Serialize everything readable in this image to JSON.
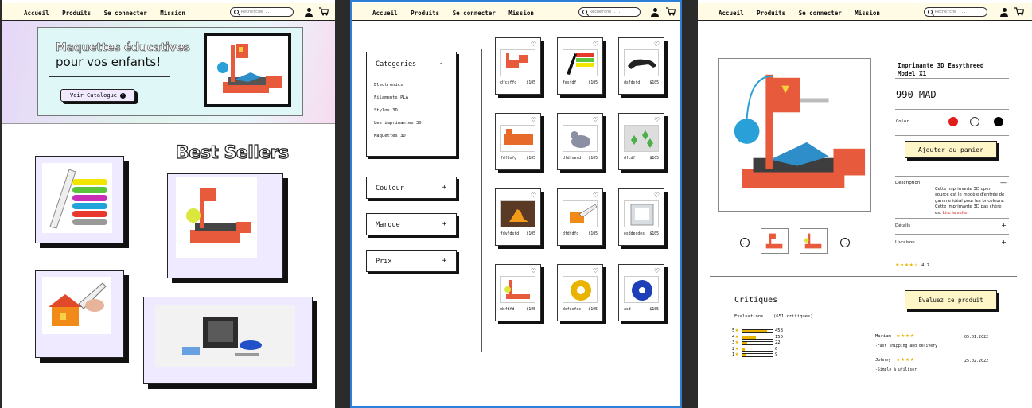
{
  "nav": {
    "home": "Accueil",
    "products": "Produits",
    "login": "Se connecter",
    "mission": "Mission",
    "search_placeholder": "Recherche ..."
  },
  "hero": {
    "title_line1": "Maquettes éducatives",
    "title_line2": "pour vos enfants!",
    "cta": "Voir Catalogue"
  },
  "best_sellers": {
    "title": "Best Sellers"
  },
  "filters": {
    "categories_title": "Categories",
    "categories_toggle": "-",
    "categories": [
      "Electronics",
      "Filaments PLA",
      "Stylos 3D",
      "Les imprimantes 3D",
      "Maquettes 3D"
    ],
    "color": "Couleur",
    "brand": "Marque",
    "price": "Prix",
    "expand": "+"
  },
  "products": [
    {
      "name": "dfcvffd",
      "price": "$105"
    },
    {
      "name": "fesfdf",
      "price": "$105"
    },
    {
      "name": "dsfdsfd",
      "price": "$105"
    },
    {
      "name": "fdfdsfg",
      "price": "$105"
    },
    {
      "name": "dfdfsesd",
      "price": "$105"
    },
    {
      "name": "dfcdf",
      "price": "$105"
    },
    {
      "name": "fdvfdsfd",
      "price": "$105"
    },
    {
      "name": "dfdfdfd",
      "price": "$105"
    },
    {
      "name": "esddesdes",
      "price": "$105"
    },
    {
      "name": "dsfdfd",
      "price": "$105"
    },
    {
      "name": "dsfdsfds",
      "price": "$105"
    },
    {
      "name": "asd",
      "price": "$105"
    }
  ],
  "product": {
    "title": "Imprimante 3D Easythreed Model X1",
    "price": "990 MAD",
    "color_label": "Color",
    "swatches": [
      "#e21b1b",
      "#ffffff",
      "#000000"
    ],
    "add_to_cart": "Ajouter au panier",
    "description_label": "Description",
    "description_toggle": "—",
    "description_text": "Cette imprimante 3D open source est le modèle d'entrée de gamme idéal pour les bricoleurs. Cette imprimante 3D pas chère est",
    "read_more": "Lire la suite",
    "details_label": "Détails",
    "delivery_label": "Livraison",
    "expand": "+",
    "rating_stars": "★★★★",
    "rating_half": "★",
    "rating_value": "4.7",
    "prev": "←",
    "next": "→"
  },
  "reviews": {
    "title": "Critiques",
    "evaluations_label": "Evaluations",
    "count_label": "(651 critiques)",
    "cta": "Évaluez ce produit",
    "star_glyph": "★",
    "distribution": [
      {
        "stars": "5",
        "count": "458",
        "fraction": 0.82
      },
      {
        "stars": "4",
        "count": "150",
        "fraction": 0.45
      },
      {
        "stars": "3",
        "count": "22",
        "fraction": 0.15
      },
      {
        "stars": "2",
        "count": "6",
        "fraction": 0.07
      },
      {
        "stars": "1",
        "count": "9",
        "fraction": 0.1
      }
    ],
    "items": [
      {
        "name": "Mariam",
        "stars": "★★★★",
        "date": "05.01.2022",
        "text": "-Fast shipping and delivery"
      },
      {
        "name": "Johnny",
        "stars": "★★★★",
        "date": "25.02.2022",
        "text": "-Simple à utiliser"
      }
    ]
  }
}
